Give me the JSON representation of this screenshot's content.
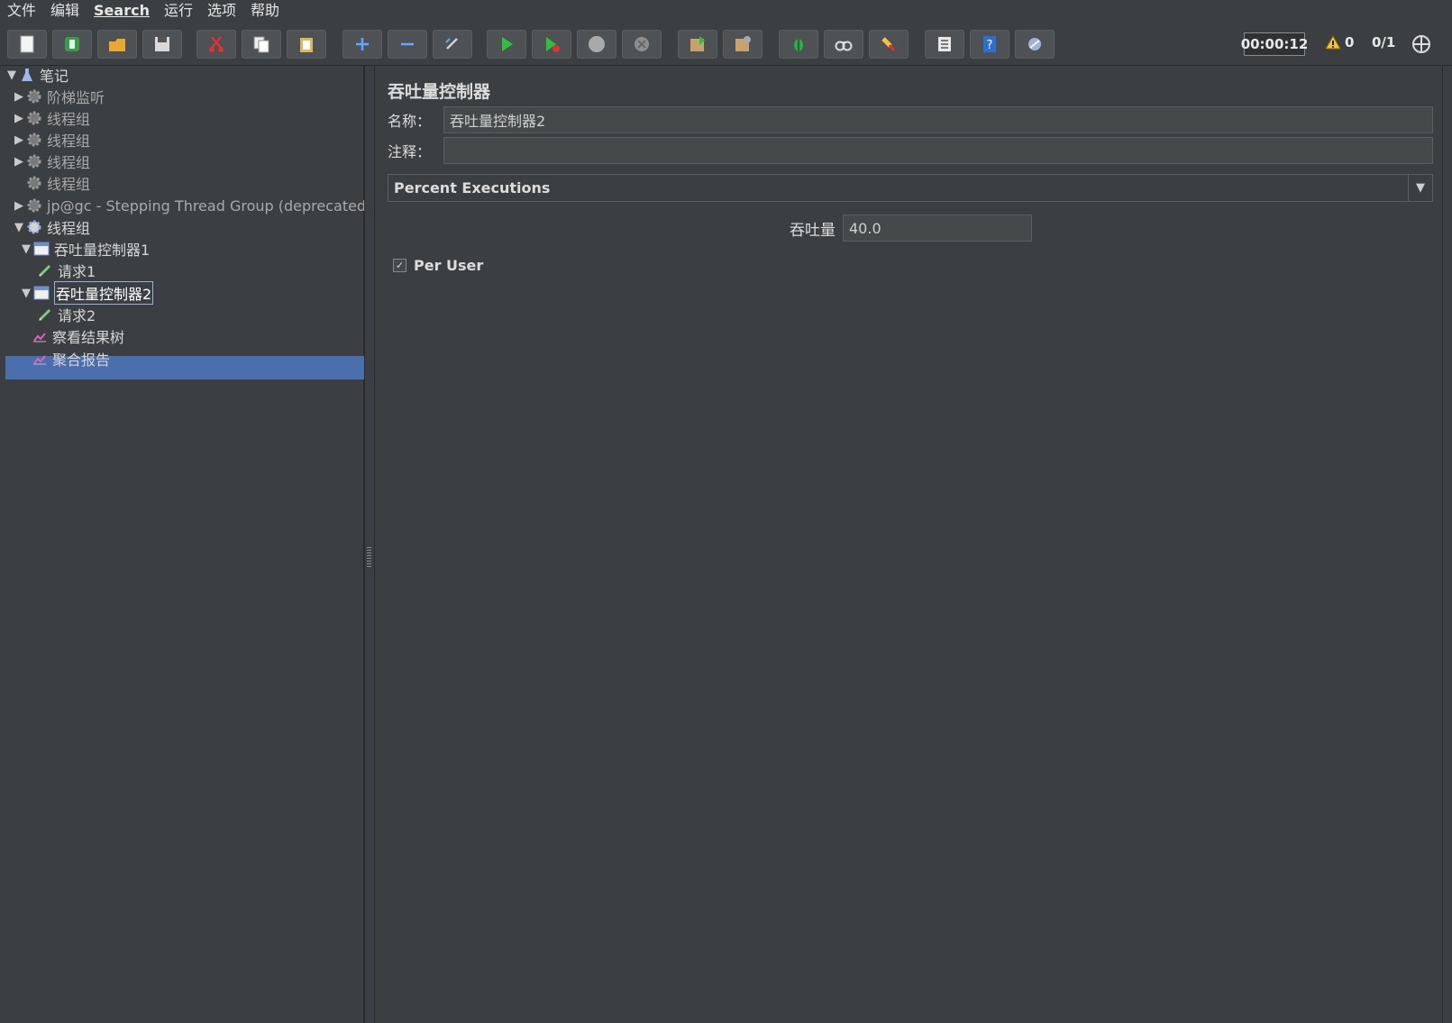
{
  "menu": [
    "文件",
    "编辑",
    "Search",
    "运行",
    "选项",
    "帮助"
  ],
  "toolbar": {
    "buttons": [
      "new-icon",
      "templates-icon",
      "open-icon",
      "save-icon",
      "cut-icon",
      "copy-icon",
      "paste-icon",
      "expand-icon",
      "collapse-icon",
      "toggle-icon",
      "start-icon",
      "start-no-pause-icon",
      "stop-icon",
      "shutdown-icon",
      "remote-start-icon",
      "remote-stop-icon",
      "function-helper-icon",
      "search-icon",
      "clear-all-icon",
      "list-icon",
      "help-icon",
      "remote-exit-icon"
    ],
    "timer": "00:00:12",
    "warnings": "0",
    "threads": "0/1"
  },
  "tree": {
    "root": "笔记",
    "nodes": [
      {
        "label": "阶梯监听"
      },
      {
        "label": "线程组"
      },
      {
        "label": "线程组"
      },
      {
        "label": "线程组"
      },
      {
        "label": "线程组"
      },
      {
        "label": "jp@gc - Stepping Thread Group (deprecated)"
      },
      {
        "label": "线程组"
      },
      {
        "label": "吞吐量控制器1"
      },
      {
        "label": "请求1"
      },
      {
        "label": "吞吐量控制器2"
      },
      {
        "label": "请求2"
      },
      {
        "label": "察看结果树"
      },
      {
        "label": "聚合报告"
      }
    ]
  },
  "panel": {
    "title": "吞吐量控制器",
    "name_label": "名称：",
    "name_value": "吞吐量控制器2",
    "comment_label": "注释：",
    "comment_value": "",
    "mode": "Percent Executions",
    "throughput_label": "吞吐量",
    "throughput_value": "40.0",
    "per_user_label": "Per User",
    "per_user_checked": true
  },
  "colors": {
    "background": "#3c3f41",
    "selection": "#4b6eaf",
    "field": "#45494a"
  }
}
